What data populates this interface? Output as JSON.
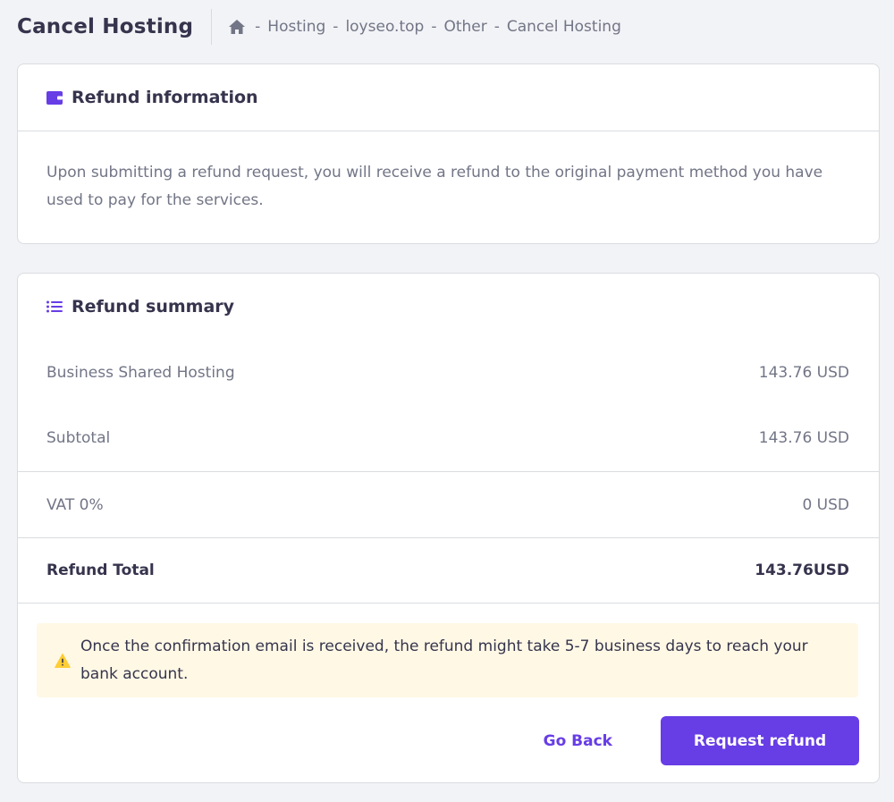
{
  "header": {
    "title": "Cancel Hosting",
    "breadcrumb": {
      "home_icon": "home-icon",
      "separator": "-",
      "items": [
        "Hosting",
        "loyseo.top",
        "Other",
        "Cancel Hosting"
      ]
    }
  },
  "refund_info": {
    "icon": "wallet-icon",
    "title": "Refund information",
    "text": "Upon submitting a refund request, you will receive a refund to the original payment method you have used to pay for the services."
  },
  "refund_summary": {
    "icon": "list-icon",
    "title": "Refund summary",
    "rows": [
      {
        "label": "Business Shared Hosting",
        "value": "143.76 USD"
      },
      {
        "label": "Subtotal",
        "value": "143.76 USD"
      },
      {
        "label": "VAT 0%",
        "value": "0 USD"
      },
      {
        "label": "Refund Total",
        "value": "143.76USD"
      }
    ],
    "alert": {
      "icon": "warning-icon",
      "text": "Once the confirmation email is received, the refund might take 5-7 business days to reach your bank account."
    },
    "actions": {
      "back_label": "Go Back",
      "submit_label": "Request refund"
    }
  },
  "colors": {
    "accent": "#673de6",
    "warning": "#ffcd35",
    "alert_bg": "#fef8e5",
    "text": "#36344d",
    "muted": "#727586"
  }
}
